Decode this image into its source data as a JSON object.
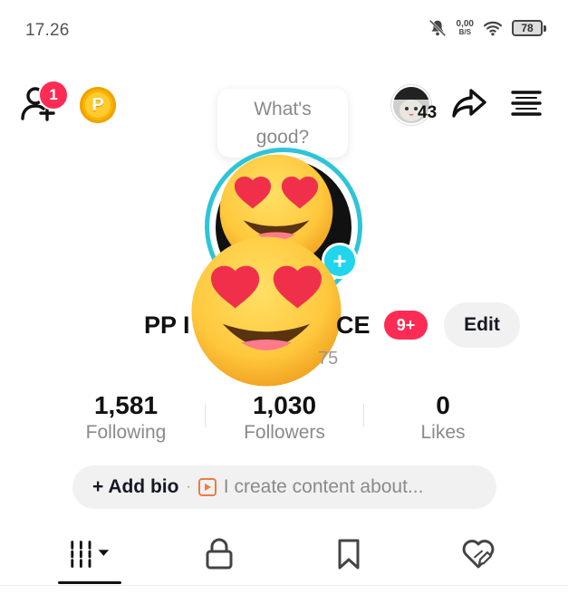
{
  "status_bar": {
    "time": "17.26",
    "net_speed_value": "0,00",
    "net_speed_unit": "B/S",
    "battery_level": "78",
    "icons": [
      "bell-muted-icon",
      "wifi-icon",
      "battery-icon"
    ]
  },
  "top_bar": {
    "notification_count": "1",
    "coin_letter": "P",
    "prompt_line1": "What's",
    "prompt_line2": "good?",
    "friends_count": "43",
    "icons": [
      "add-friend-icon",
      "coin-icon",
      "share-icon",
      "menu-icon"
    ]
  },
  "profile": {
    "name_left": "PP I",
    "name_right": "CE",
    "name_badge": "9+",
    "handle_visible": "75",
    "edit_label": "Edit",
    "ring_color": "#2ec4d8",
    "badge_color": "#fe2c55"
  },
  "stats": [
    {
      "value": "1,581",
      "label": "Following"
    },
    {
      "value": "1,030",
      "label": "Followers"
    },
    {
      "value": "0",
      "label": "Likes"
    }
  ],
  "bio": {
    "add_label": "+ Add bio",
    "separator": "·",
    "placeholder": "I create content about..."
  },
  "tabs": [
    {
      "icon": "grid-videos-icon",
      "active": true
    },
    {
      "icon": "lock-icon",
      "active": false
    },
    {
      "icon": "bookmark-icon",
      "active": false
    },
    {
      "icon": "liked-heart-icon",
      "active": false
    }
  ]
}
